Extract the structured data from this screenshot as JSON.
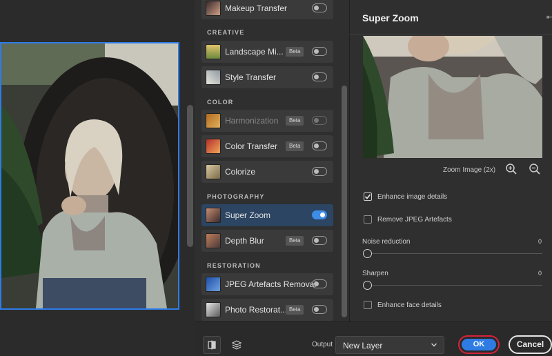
{
  "panel": {
    "title": "Super Zoom",
    "zoom_label": "Zoom Image (2x)"
  },
  "filters": {
    "top_item": {
      "label": "Makeup Transfer",
      "enabled": false
    },
    "sections": [
      {
        "label": "CREATIVE",
        "items": [
          {
            "label": "Landscape Mi...",
            "badge": "Beta",
            "enabled": false
          },
          {
            "label": "Style Transfer",
            "enabled": false
          }
        ]
      },
      {
        "label": "COLOR",
        "items": [
          {
            "label": "Harmonization",
            "badge": "Beta",
            "enabled": false,
            "disabled": true
          },
          {
            "label": "Color Transfer",
            "badge": "Beta",
            "enabled": false
          },
          {
            "label": "Colorize",
            "enabled": false
          }
        ]
      },
      {
        "label": "PHOTOGRAPHY",
        "items": [
          {
            "label": "Super Zoom",
            "enabled": true,
            "selected": true
          },
          {
            "label": "Depth Blur",
            "badge": "Beta",
            "enabled": false
          }
        ]
      },
      {
        "label": "RESTORATION",
        "items": [
          {
            "label": "JPEG Artefacts Removal",
            "enabled": false
          },
          {
            "label": "Photo Restorat...",
            "badge": "Beta",
            "enabled": false
          }
        ]
      }
    ]
  },
  "options": {
    "enhance_details": {
      "label": "Enhance image details",
      "checked": true
    },
    "remove_jpeg": {
      "label": "Remove JPEG Artefacts",
      "checked": false
    },
    "noise": {
      "label": "Noise reduction",
      "value": "0"
    },
    "sharpen": {
      "label": "Sharpen",
      "value": "0"
    },
    "face": {
      "label": "Enhance face details",
      "checked": false
    }
  },
  "bottom": {
    "output_label": "Output",
    "output_value": "New Layer",
    "ok_label": "OK",
    "cancel_label": "Cancel"
  },
  "colors": {
    "accent": "#2f7be4",
    "highlight_border": "#d8233b",
    "selection": "#2b4563"
  }
}
